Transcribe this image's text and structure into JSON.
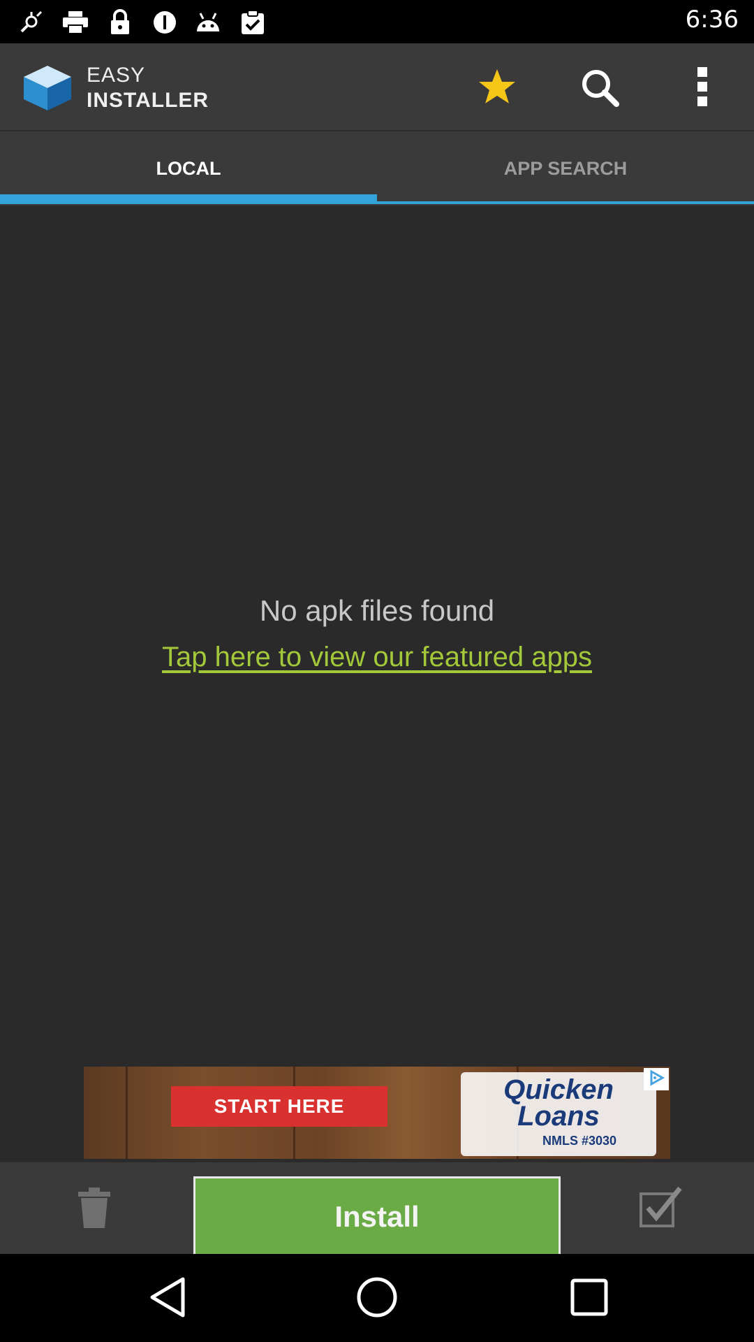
{
  "status_bar": {
    "time": "6:36",
    "icons": [
      "gps-icon",
      "printer-icon",
      "lock-icon",
      "do-not-disturb-icon",
      "android-icon",
      "clipboard-check-icon"
    ]
  },
  "app_bar": {
    "title_line1": "EASY",
    "title_line2": "INSTALLER",
    "actions": [
      "star-icon",
      "search-icon",
      "overflow-menu-icon"
    ],
    "star_color": "#f5c518"
  },
  "tabs": [
    {
      "label": "LOCAL",
      "selected": true
    },
    {
      "label": "APP SEARCH",
      "selected": false
    }
  ],
  "accent_color": "#33a3d9",
  "content": {
    "empty_message": "No apk files found",
    "featured_link": "Tap here to view our featured apps"
  },
  "ad": {
    "cta": "START HERE",
    "brand_line1": "Quicken",
    "brand_line2": "Loans",
    "nmls": "NMLS #3030"
  },
  "bottom_bar": {
    "install_label": "Install",
    "install_color": "#6aab46"
  },
  "nav_bar": {
    "buttons": [
      "back-icon",
      "home-icon",
      "recents-icon"
    ]
  }
}
